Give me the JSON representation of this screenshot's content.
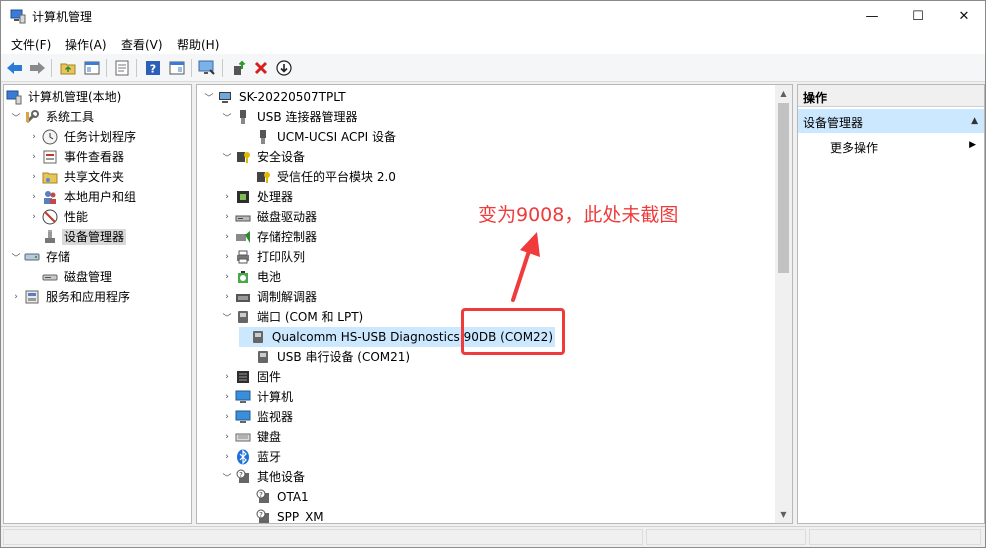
{
  "window": {
    "title": "计算机管理",
    "controls": {
      "minimize": "—",
      "maximize": "☐",
      "close": "✕"
    }
  },
  "menu": [
    {
      "label": "文件(F)"
    },
    {
      "label": "操作(A)"
    },
    {
      "label": "查看(V)"
    },
    {
      "label": "帮助(H)"
    }
  ],
  "toolbar": [
    "back-icon",
    "forward-icon",
    "up-folder-icon",
    "show-hide-tree-icon",
    "properties-icon",
    "help-icon",
    "action-pane-icon",
    "scan-hardware-icon",
    "update-driver-icon",
    "uninstall-icon",
    "disable-device-icon"
  ],
  "left_tree": [
    {
      "label": "计算机管理(本地)",
      "icon": "computer-management-icon"
    },
    {
      "label": "系统工具",
      "icon": "tools-icon",
      "expanded": true
    },
    {
      "label": "任务计划程序",
      "icon": "clock-icon"
    },
    {
      "label": "事件查看器",
      "icon": "event-viewer-icon"
    },
    {
      "label": "共享文件夹",
      "icon": "shared-folder-icon"
    },
    {
      "label": "本地用户和组",
      "icon": "users-icon"
    },
    {
      "label": "性能",
      "icon": "performance-icon"
    },
    {
      "label": "设备管理器",
      "icon": "device-manager-icon",
      "selected": true
    },
    {
      "label": "存储",
      "icon": "storage-icon",
      "expanded": true
    },
    {
      "label": "磁盘管理",
      "icon": "disk-icon"
    },
    {
      "label": "服务和应用程序",
      "icon": "services-icon"
    }
  ],
  "device_tree": [
    {
      "label": "SK-20220507TPLT",
      "icon": "computer-icon",
      "expanded": true
    },
    {
      "label": "USB 连接器管理器",
      "icon": "usb-icon",
      "expanded": true
    },
    {
      "label": "UCM-UCSI ACPI 设备",
      "icon": "usb-icon"
    },
    {
      "label": "安全设备",
      "icon": "security-device-icon",
      "expanded": true
    },
    {
      "label": "受信任的平台模块 2.0",
      "icon": "tpm-icon"
    },
    {
      "label": "处理器",
      "icon": "processor-icon"
    },
    {
      "label": "磁盘驱动器",
      "icon": "disk-drive-icon"
    },
    {
      "label": "存储控制器",
      "icon": "storage-controller-icon"
    },
    {
      "label": "打印队列",
      "icon": "printer-icon"
    },
    {
      "label": "电池",
      "icon": "battery-icon"
    },
    {
      "label": "调制解调器",
      "icon": "modem-icon"
    },
    {
      "label": "端口 (COM 和 LPT)",
      "icon": "port-icon",
      "expanded": true
    },
    {
      "label": "Qualcomm HS-USB Diagnostics 90DB (COM22)",
      "icon": "port-icon",
      "selected": true
    },
    {
      "label": "USB 串行设备 (COM21)",
      "icon": "port-icon"
    },
    {
      "label": "固件",
      "icon": "firmware-icon"
    },
    {
      "label": "计算机",
      "icon": "monitor-icon"
    },
    {
      "label": "监视器",
      "icon": "monitor-icon"
    },
    {
      "label": "键盘",
      "icon": "keyboard-icon"
    },
    {
      "label": "蓝牙",
      "icon": "bluetooth-icon"
    },
    {
      "label": "其他设备",
      "icon": "unknown-device-icon",
      "expanded": true
    },
    {
      "label": "OTA1",
      "icon": "unknown-device-icon"
    },
    {
      "label": "SPP_XM",
      "icon": "unknown-device-icon"
    }
  ],
  "actions": {
    "header": "操作",
    "section": "设备管理器",
    "item": "更多操作"
  },
  "annotation": {
    "text": "变为9008，此处未截图",
    "color": "#ef3b3b"
  }
}
